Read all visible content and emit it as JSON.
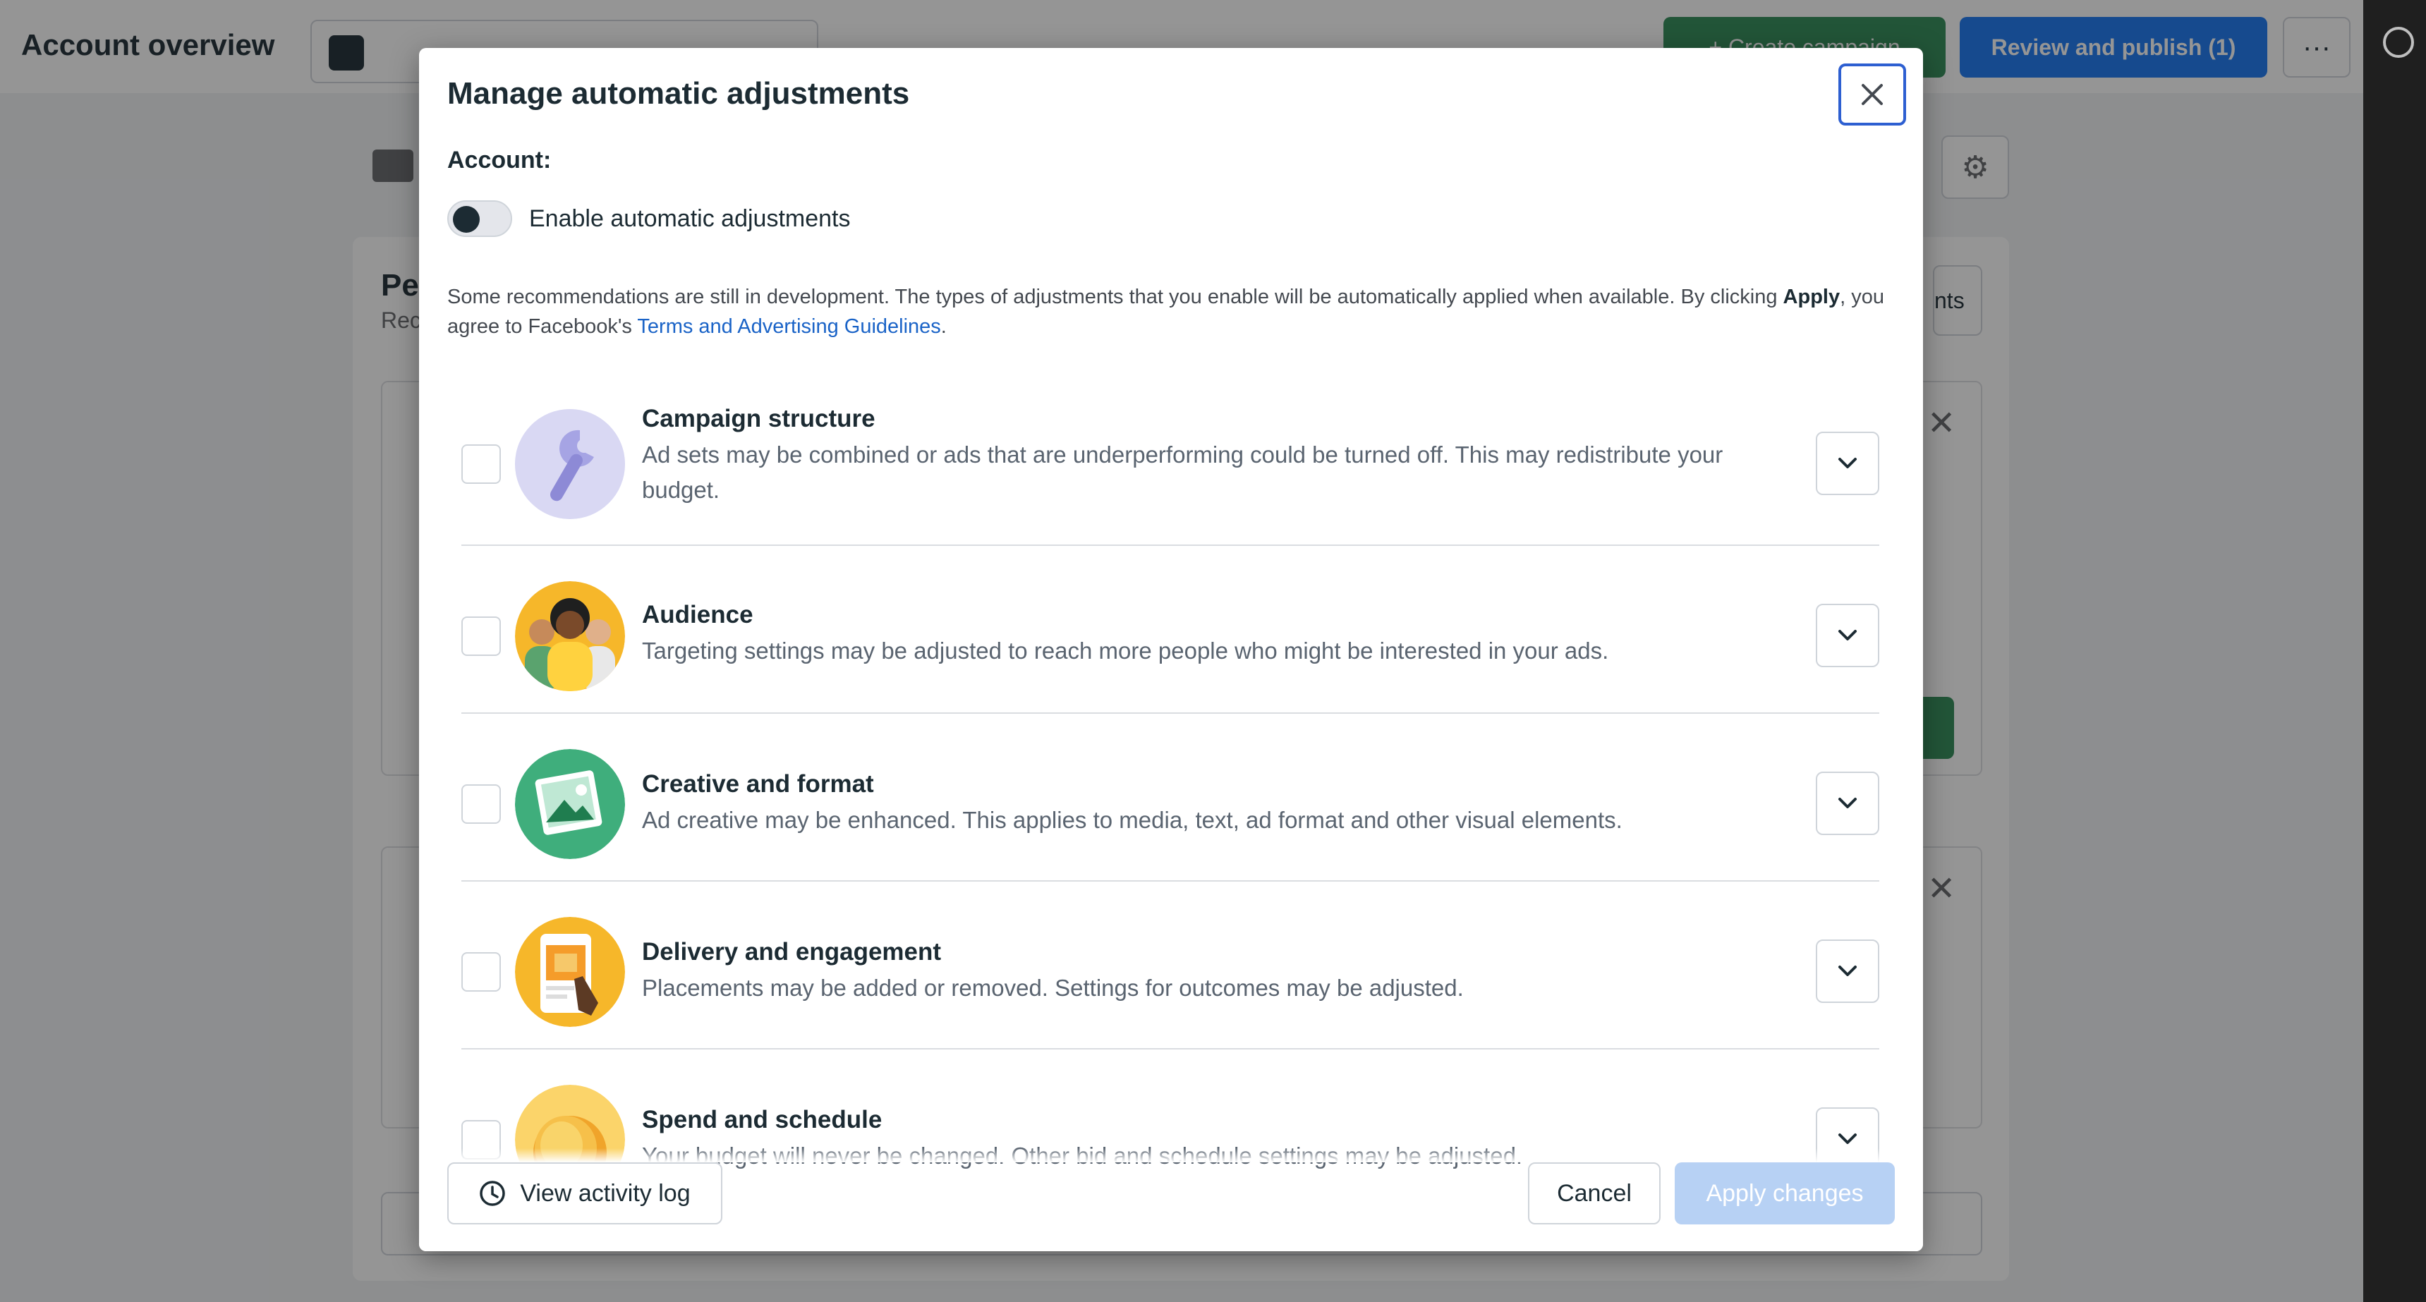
{
  "background": {
    "page_title": "Account overview",
    "create_label": "+ Create campaign",
    "review_label": "Review and publish (1)",
    "more_label": "···",
    "card_title": "Pe",
    "card_sub": "Rec",
    "side_tab": "nts"
  },
  "modal": {
    "title": "Manage automatic adjustments",
    "account_label": "Account:",
    "toggle_label": "Enable automatic adjustments",
    "toggle_on": false,
    "notice_text_1": "Some recommendations are still in development. The types of adjustments that you enable will be automatically applied when available. By clicking ",
    "notice_bold": "Apply",
    "notice_text_2": ", you agree to Facebook's ",
    "notice_link": "Terms and Advertising Guidelines",
    "notice_end": ".",
    "items": [
      {
        "title": "Campaign structure",
        "desc": "Ad sets may be combined or ads that are underperforming could be turned off. This may redistribute your budget.",
        "icon": "wrench-icon"
      },
      {
        "title": "Audience",
        "desc": "Targeting settings may be adjusted to reach more people who might be interested in your ads.",
        "icon": "people-icon"
      },
      {
        "title": "Creative and format",
        "desc": "Ad creative may be enhanced. This applies to media, text, ad format and other visual elements.",
        "icon": "image-icon"
      },
      {
        "title": "Delivery and engagement",
        "desc": "Placements may be added or removed. Settings for outcomes may be adjusted.",
        "icon": "tap-icon"
      },
      {
        "title": "Spend and schedule",
        "desc": "Your budget will never be changed. Other bid and schedule settings may be adjusted.",
        "icon": "coins-icon"
      }
    ],
    "view_log_label": "View activity log",
    "cancel_label": "Cancel",
    "apply_label": "Apply changes"
  },
  "colors": {
    "primary_blue": "#1877f2",
    "link_blue": "#1a63c7",
    "apply_disabled": "#b7d1f4",
    "green": "#2e8b57"
  }
}
